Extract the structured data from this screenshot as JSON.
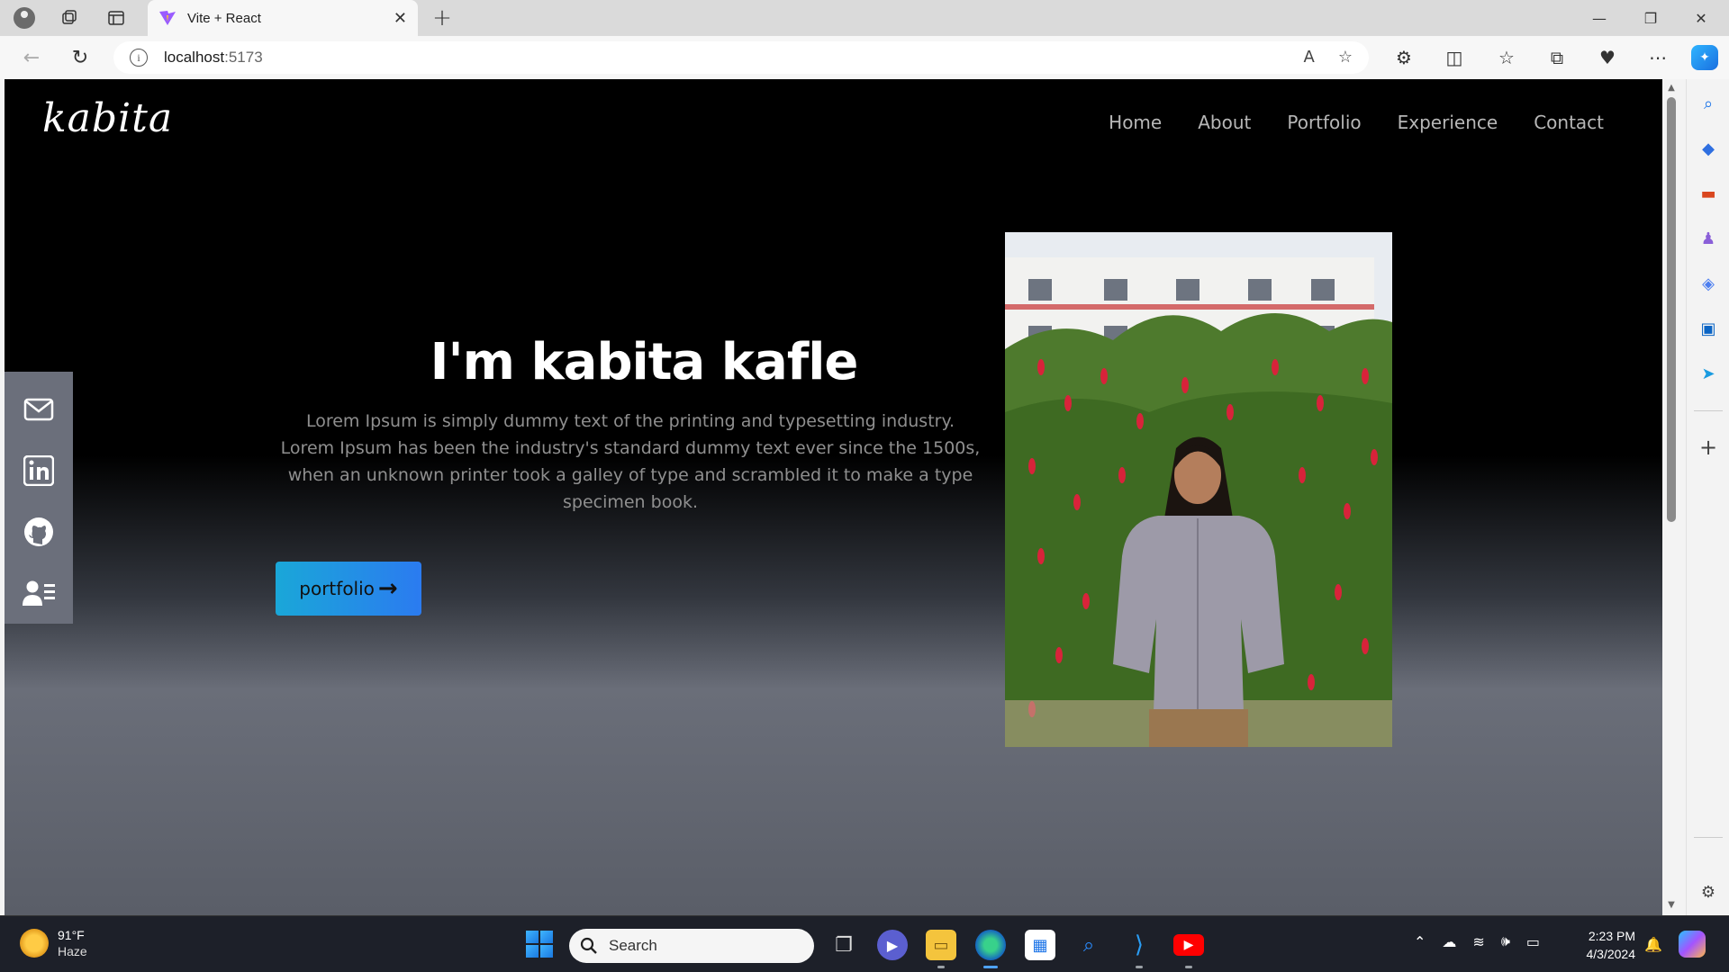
{
  "browser": {
    "tab_title": "Vite + React",
    "url_host": "localhost",
    "url_port": ":5173",
    "new_tab_symbol": "+",
    "close_symbol": "✕"
  },
  "site": {
    "logo": "kabita",
    "nav": [
      "Home",
      "About",
      "Portfolio",
      "Experience",
      "Contact"
    ],
    "hero": {
      "title": "I'm kabita kafle",
      "text": "Lorem Ipsum is simply dummy text of the printing and typesetting industry. Lorem Ipsum has been the industry's standard dummy text ever since the 1500s, when an unknown printer took a galley of type and scrambled it to make a type specimen book.",
      "button_label": "portfolio",
      "button_arrow": "→"
    },
    "social_icons": [
      "mail-icon",
      "linkedin-icon",
      "github-icon",
      "resume-icon"
    ]
  },
  "taskbar": {
    "weather_temp": "91°F",
    "weather_desc": "Haze",
    "search_label": "Search",
    "time": "2:23 PM",
    "date": "4/3/2024"
  },
  "colors": {
    "button_gradient_start": "#1aa7d8",
    "button_gradient_end": "#2b7bf0",
    "social_bar": "#6b6f7b",
    "nav_text": "#b7b7b7"
  }
}
